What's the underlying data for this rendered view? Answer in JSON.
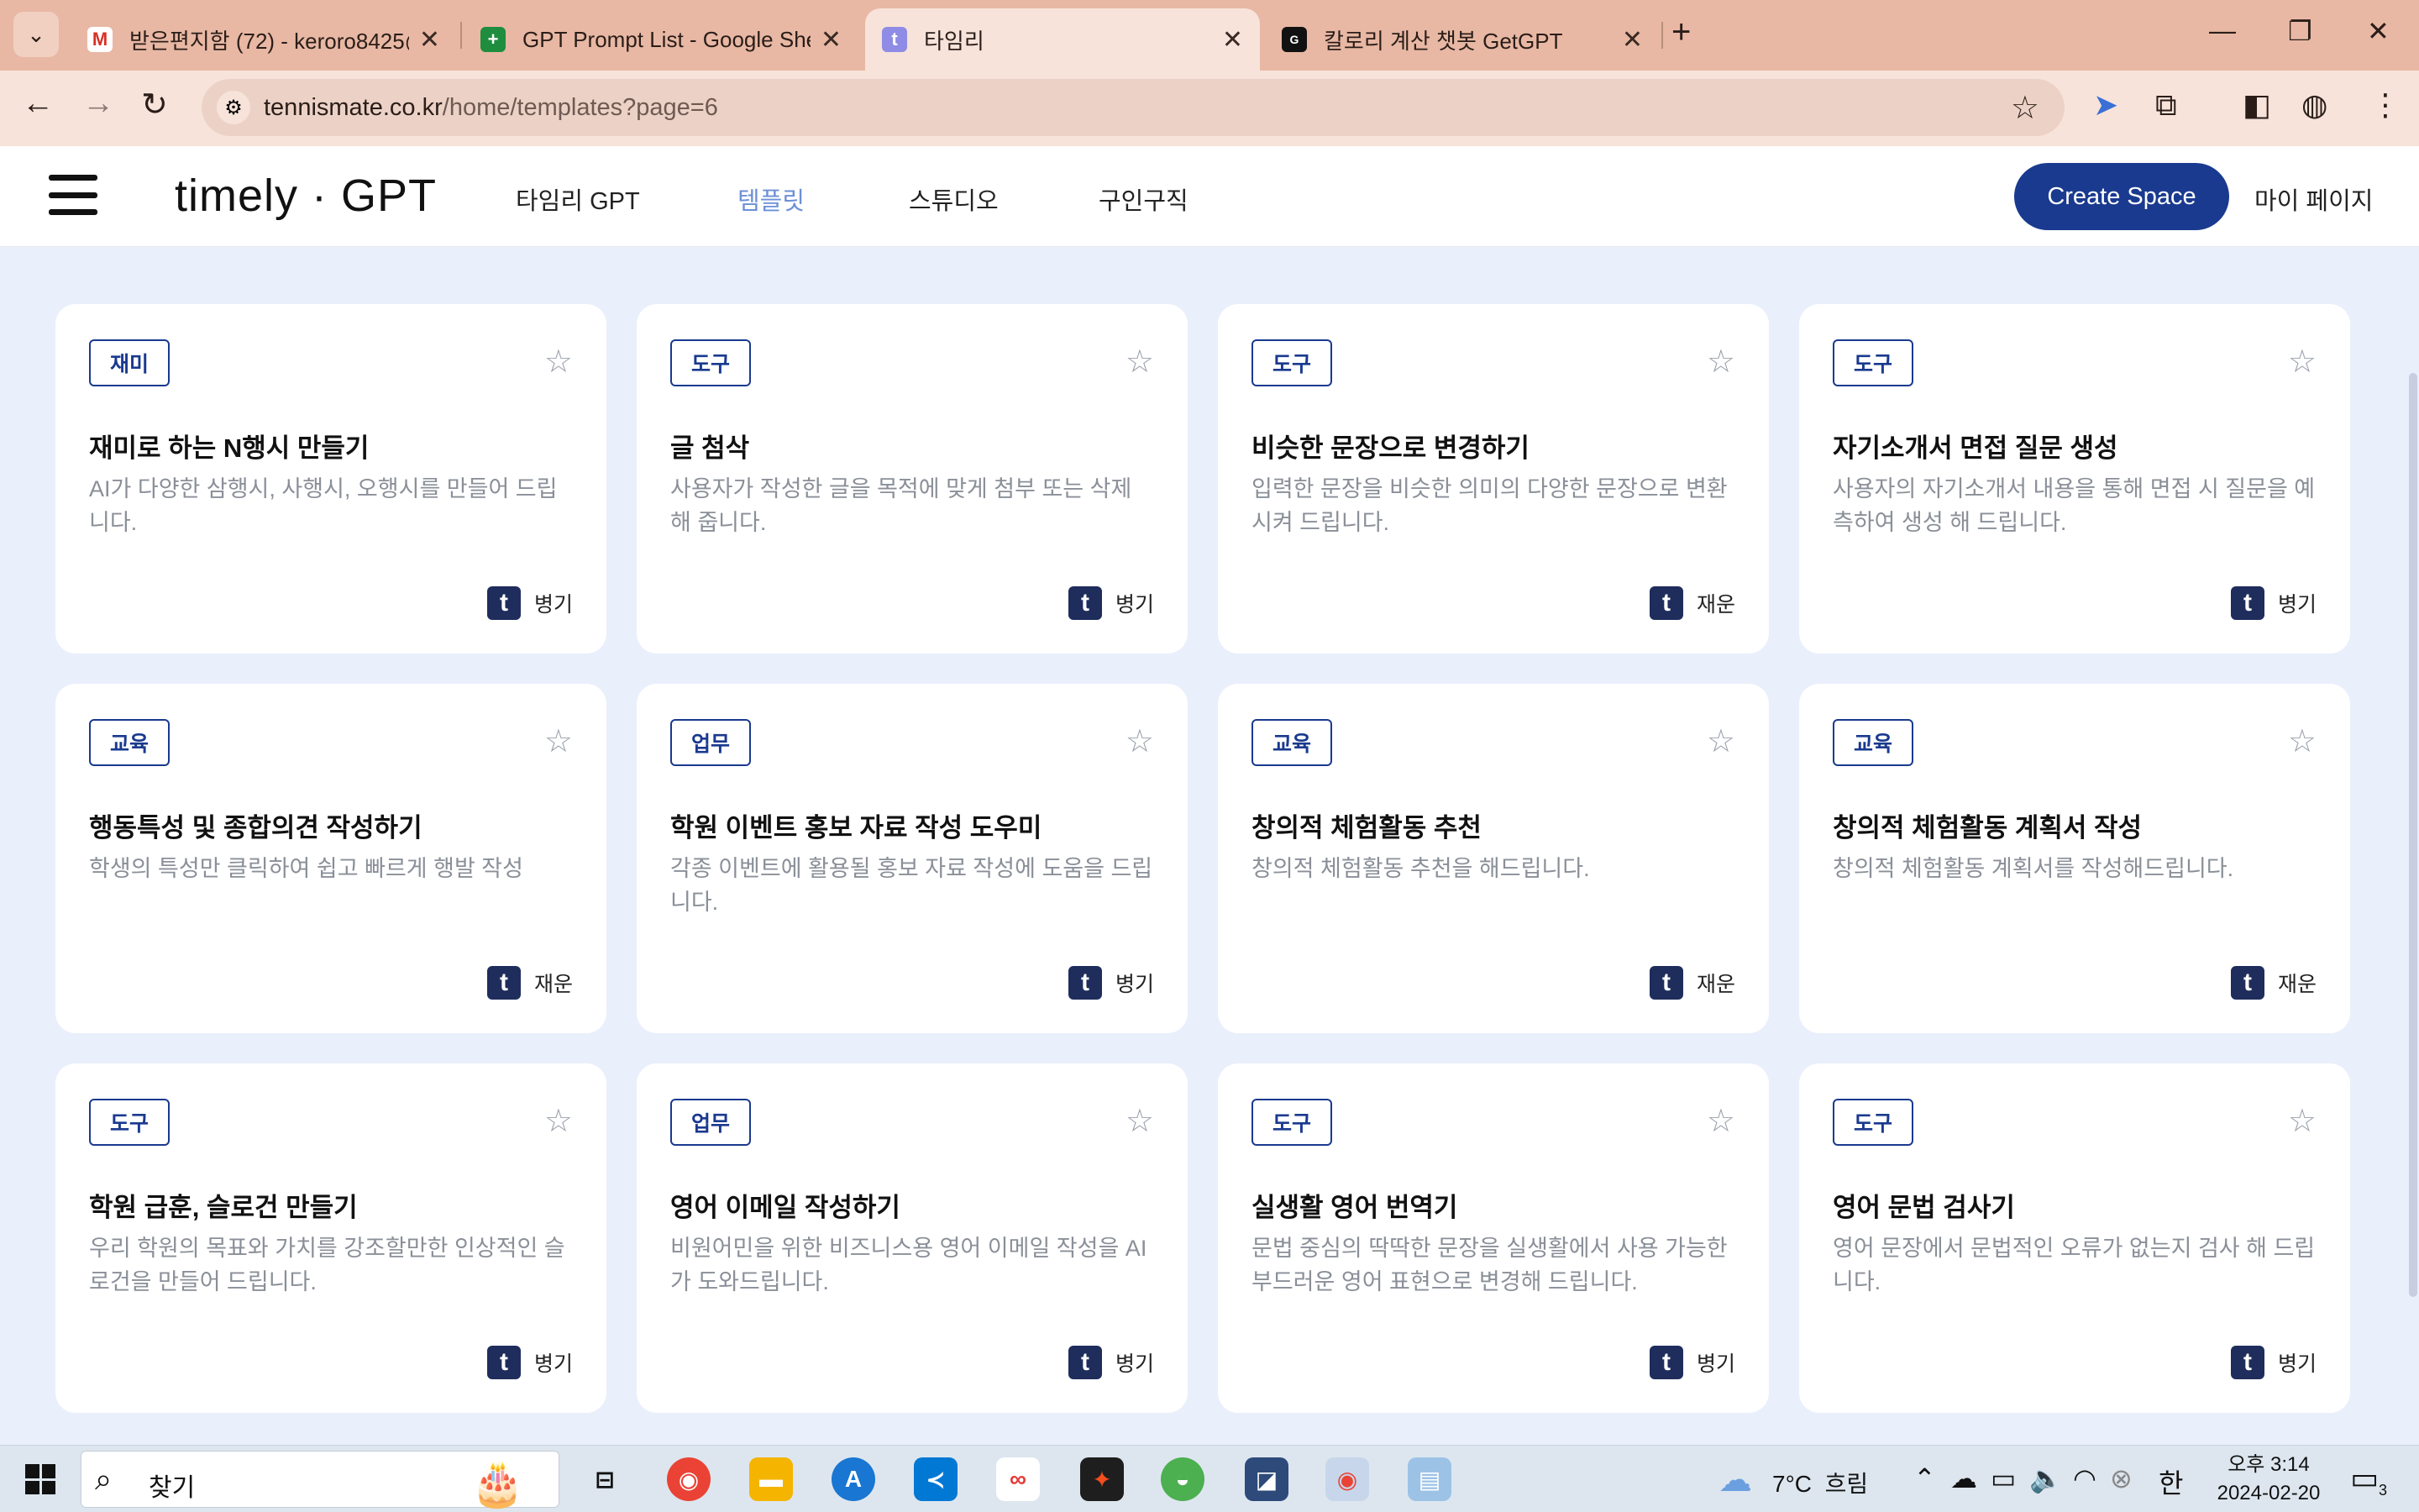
{
  "browser": {
    "tabs": [
      {
        "title": "받은편지함 (72) - keroro8425@",
        "icon": "gmail-icon",
        "color": "#d93025",
        "glyph": "M"
      },
      {
        "title": "GPT Prompt List - Google She",
        "icon": "google-sheets-icon",
        "color": "#1e8e3e",
        "glyph": "+"
      },
      {
        "title": "타임리",
        "icon": "timely-icon",
        "color": "#8f8ce6",
        "glyph": "t"
      },
      {
        "title": "칼로리 계산 챗봇 GetGPT",
        "icon": "getgpt-icon",
        "color": "#111111",
        "glyph": "G"
      }
    ],
    "url_host": "tennismate.co.kr",
    "url_path": "/home/templates?page=6"
  },
  "site": {
    "logo": "timely · GPT",
    "nav": [
      "타임리 GPT",
      "템플릿",
      "스튜디오",
      "구인구직"
    ],
    "create_button": "Create Space",
    "mypage": "마이 페이지"
  },
  "cards": [
    {
      "tag": "재미",
      "title": "재미로 하는 N행시 만들기",
      "desc": "AI가 다양한 삼행시, 사행시, 오행시를 만들어 드립니다.",
      "author": "병기"
    },
    {
      "tag": "도구",
      "title": "글 첨삭",
      "desc": "사용자가 작성한 글을 목적에 맞게 첨부 또는 삭제 해 줍니다.",
      "author": "병기"
    },
    {
      "tag": "도구",
      "title": "비슷한 문장으로 변경하기",
      "desc": "입력한 문장을 비슷한 의미의 다양한 문장으로 변환 시켜 드립니다.",
      "author": "재운"
    },
    {
      "tag": "도구",
      "title": "자기소개서 면접 질문 생성",
      "desc": "사용자의 자기소개서 내용을 통해 면접 시 질문을 예측하여 생성 해 드립니다.",
      "author": "병기"
    },
    {
      "tag": "교육",
      "title": "행동특성 및 종합의견 작성하기",
      "desc": "학생의 특성만 클릭하여 쉽고 빠르게 행발 작성",
      "author": "재운"
    },
    {
      "tag": "업무",
      "title": "학원 이벤트 홍보 자료 작성 도우미",
      "desc": "각종 이벤트에 활용될 홍보 자료 작성에 도움을 드립니다.",
      "author": "병기"
    },
    {
      "tag": "교육",
      "title": "창의적 체험활동 추천",
      "desc": "창의적 체험활동 추천을 해드립니다.",
      "author": "재운"
    },
    {
      "tag": "교육",
      "title": "창의적 체험활동 계획서 작성",
      "desc": "창의적 체험활동 계획서를 작성해드립니다.",
      "author": "재운"
    },
    {
      "tag": "도구",
      "title": "학원 급훈, 슬로건 만들기",
      "desc": "우리 학원의 목표와 가치를 강조할만한 인상적인 슬로건을 만들어 드립니다.",
      "author": "병기"
    },
    {
      "tag": "업무",
      "title": "영어 이메일 작성하기",
      "desc": "비원어민을 위한 비즈니스용 영어 이메일 작성을 AI가 도와드립니다.",
      "author": "병기"
    },
    {
      "tag": "도구",
      "title": "실생활 영어 번역기",
      "desc": "문법 중심의 딱딱한 문장을 실생활에서 사용 가능한 부드러운 영어 표현으로 변경해 드립니다.",
      "author": "병기"
    },
    {
      "tag": "도구",
      "title": "영어 문법 검사기",
      "desc": "영어 문장에서 문법적인 오류가 없는지 검사 해 드립니다.",
      "author": "병기"
    }
  ],
  "taskbar": {
    "search_placeholder": "찾기",
    "weather_temp": "7°C",
    "weather_desc": "흐림",
    "ime": "한",
    "time": "오후 3:14",
    "date": "2024-02-20",
    "notifications": "3"
  }
}
